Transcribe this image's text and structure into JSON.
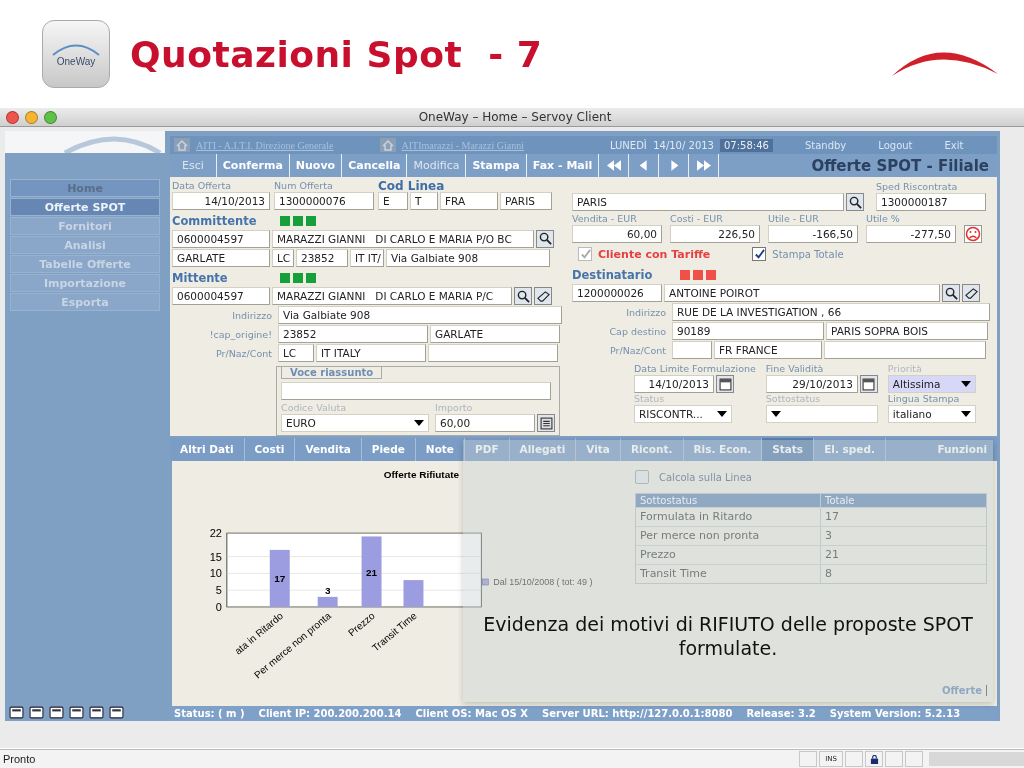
{
  "slide": {
    "logo_text": "OneWay",
    "title": "Quotazioni Spot  - 7"
  },
  "window": {
    "title": "OneWay – Home – Servoy Client"
  },
  "sidebar": {
    "items": [
      {
        "label": "Home",
        "selected": false
      },
      {
        "label": "Offerte SPOT",
        "selected": true
      },
      {
        "label": "Fornitori",
        "selected": false
      },
      {
        "label": "Analisi",
        "selected": false
      },
      {
        "label": "Tabelle Offerte",
        "selected": false
      },
      {
        "label": "Importazione",
        "selected": false
      },
      {
        "label": "Esporta",
        "selected": false
      }
    ]
  },
  "top_bar": {
    "company": "AITI - A.I.T.I. Direzione Generale",
    "user": "AITImarazzi - Marazzi Gianni",
    "date": "LUNEDÌ  14/10/ 2013",
    "time": "07:58:46",
    "links": [
      "Standby",
      "Logout",
      "Exit"
    ]
  },
  "toolbar": {
    "buttons": [
      {
        "label": "Esci",
        "disabled": true
      },
      {
        "label": "Conferma",
        "disabled": false
      },
      {
        "label": "Nuovo",
        "disabled": false
      },
      {
        "label": "Cancella",
        "disabled": false
      },
      {
        "label": "Modifica",
        "disabled": true
      },
      {
        "label": "Stampa",
        "disabled": false
      },
      {
        "label": "Fax - Mail",
        "disabled": false
      }
    ],
    "title": "Offerte SPOT - Filiale"
  },
  "form": {
    "data_offerta": {
      "label": "Data Offerta",
      "value": "14/10/2013"
    },
    "num_offerta": {
      "label": "Num Offerta",
      "value": "1300000076"
    },
    "cod_linea": {
      "label": "Cod Linea",
      "values": [
        "E",
        "T",
        "FRA",
        "PARIS"
      ]
    },
    "line_destination": "PARIS",
    "sped_riscontrata": {
      "label": "Sped Riscontrata",
      "value": "1300000187"
    },
    "amounts": [
      {
        "label": "Vendita - EUR",
        "value": "60,00"
      },
      {
        "label": "Costi - EUR",
        "value": "226,50"
      },
      {
        "label": "Utile - EUR",
        "value": "-166,50"
      },
      {
        "label": "Utile %",
        "value": "-277,50"
      }
    ],
    "cliente_con_tariffe": {
      "label": "Cliente con Tariffe",
      "checked": true,
      "disabled": true
    },
    "stampa_totale": {
      "label": "Stampa Totale",
      "checked": true,
      "disabled": false
    },
    "committente": {
      "title": "Committente",
      "indicators": [
        {
          "color": "#16a03c"
        },
        {
          "color": "#16a03c"
        },
        {
          "color": "#16a03c"
        }
      ],
      "code": "0600004597",
      "name": "MARAZZI GIANNI   DI CARLO E MARIA P/O BC",
      "city": "GARLATE",
      "province": "LC",
      "cap": "23852",
      "country": "IT IT/",
      "address": "Via Galbiate 908"
    },
    "mittente": {
      "title": "Mittente",
      "indicators": [
        {
          "color": "#16a03c"
        },
        {
          "color": "#16a03c"
        },
        {
          "color": "#16a03c"
        }
      ],
      "code": "0600004597",
      "name": "MARAZZI GIANNI   DI CARLO E MARIA P/C",
      "address_label": "Indirizzo",
      "address": "Via Galbiate 908",
      "cap_label": "!cap_origine!",
      "cap": "23852",
      "city": "GARLATE",
      "region_label": "Pr/Naz/Cont",
      "province": "LC",
      "country": "IT ITALY"
    },
    "destinatario": {
      "title": "Destinatario",
      "indicators": [
        {
          "color": "#f0504a"
        },
        {
          "color": "#f0504a"
        },
        {
          "color": "#f0504a"
        }
      ],
      "code": "1200000026",
      "name": "ANTOINE POIROT",
      "address_label": "Indirizzo",
      "address": "RUE DE LA INVESTIGATION , 66",
      "cap_label": "Cap destino",
      "cap": "90189",
      "city": "PARIS SOPRA BOIS",
      "region_label": "Pr/Naz/Cont",
      "country": "FR FRANCE"
    },
    "voce_riassunto": {
      "title": "Voce riassunto",
      "valuta_label": "Codice Valuta",
      "valuta": "EURO",
      "importo_label": "Importo",
      "importo": "60,00"
    },
    "dates": {
      "limite_label": "Data Limite Formulazione",
      "limite": "14/10/2013",
      "fine_label": "Fine Validità",
      "fine": "29/10/2013",
      "priorita_label": "Priorità",
      "priorita": "Altissima",
      "status_label": "Status",
      "status": "RISCONTR...",
      "sottostatus_label": "Sottostatus",
      "lingua_label": "Lingua Stampa",
      "lingua": "italiano"
    }
  },
  "tabs": [
    {
      "label": "Altri Dati",
      "selected": false
    },
    {
      "label": "Costi",
      "selected": false
    },
    {
      "label": "Vendita",
      "selected": false
    },
    {
      "label": "Piede",
      "selected": false
    },
    {
      "label": "Note",
      "selected": false
    },
    {
      "label": "PDF",
      "selected": false
    },
    {
      "label": "Allegati",
      "selected": false
    },
    {
      "label": "Vita",
      "selected": false
    },
    {
      "label": "Ricont.",
      "selected": false
    },
    {
      "label": "Ris. Econ.",
      "selected": false
    },
    {
      "label": "Stats",
      "selected": true
    },
    {
      "label": "El. sped.",
      "selected": false
    },
    {
      "label": "Funzioni",
      "selected": false
    }
  ],
  "stats": {
    "chart_data": {
      "type": "bar",
      "title": "Offerte Rifiutate",
      "categories": [
        "ata in Ritardo",
        "Per merce non pronta",
        "Prezzo",
        "Transit Time"
      ],
      "series": [
        {
          "name": "Dal 15/10/2008 ( tot: 49 )",
          "color": "#9c9ce0",
          "values": [
            17,
            3,
            21,
            8
          ]
        }
      ],
      "ylim": [
        0,
        22
      ],
      "yticks": [
        0,
        5,
        10,
        15,
        22
      ],
      "grid": true,
      "value_labels": [
        "17",
        "3",
        "21",
        null
      ]
    },
    "calcola": {
      "label": "Calcola sulla Linea",
      "checked": false
    },
    "table": {
      "columns": [
        "Sottostatus",
        "Totale"
      ],
      "rows": [
        [
          "Formulata in Ritardo",
          "17"
        ],
        [
          "Per merce non pronta",
          "3"
        ],
        [
          "Prezzo",
          "21"
        ],
        [
          "Transit Time",
          "8"
        ]
      ]
    },
    "footer_link": "Offerte"
  },
  "callout": {
    "text": "Evidenza dei motivi di RIFIUTO delle proposte SPOT formulate."
  },
  "status_bar": [
    "Status: ( m )",
    "Client IP: 200.200.200.14",
    "Client OS: Mac OS X",
    "Server URL: http://127.0.0.1:8080",
    "Release: 3.2",
    "System Version: 5.2.13"
  ],
  "app_status": {
    "text": "Pronto",
    "indicator": "INS"
  }
}
